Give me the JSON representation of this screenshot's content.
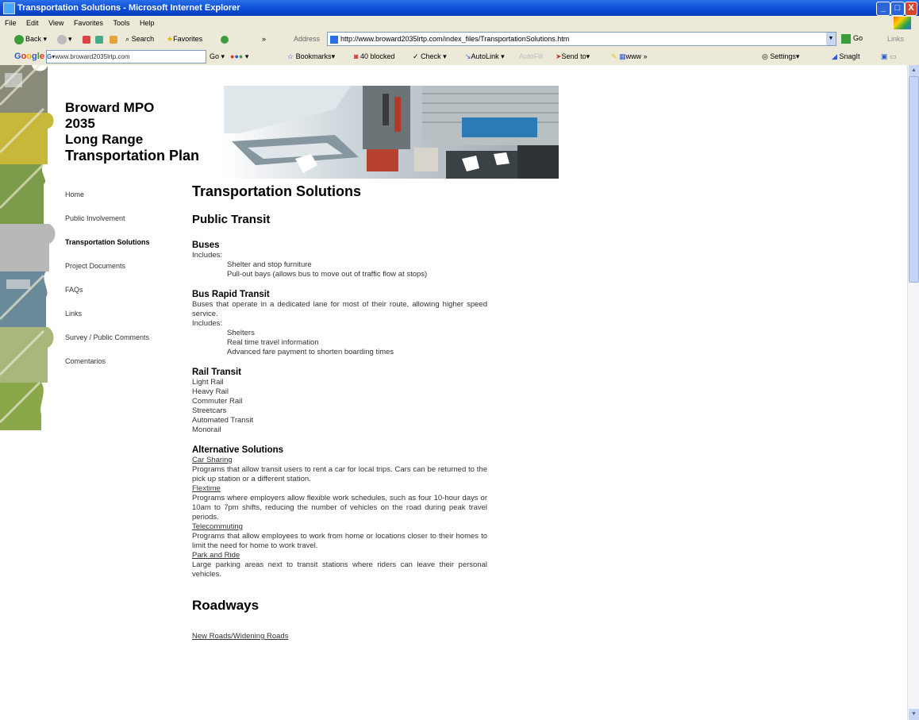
{
  "window": {
    "title": "Transportation Solutions - Microsoft Internet Explorer",
    "controls": [
      "_",
      "□",
      "X"
    ]
  },
  "menu": [
    "File",
    "Edit",
    "View",
    "Favorites",
    "Tools",
    "Help"
  ],
  "toolbar": {
    "back": "Back",
    "search": "Search",
    "favorites": "Favorites",
    "address_label": "Address",
    "address_url": "http://www.broward2035lrtp.com/index_files/TransportationSolutions.htm",
    "go": "Go",
    "links": "Links"
  },
  "google_bar": {
    "logo": "Google",
    "search_value": "www.broward2035lrtp.com",
    "go": "Go",
    "bookmarks": "Bookmarks",
    "blocked": "40 blocked",
    "check": "Check",
    "autolink": "AutoLink",
    "autofill": "AutoFill",
    "sendto": "Send to",
    "more": "www",
    "settings": "Settings",
    "snagit": "SnagIt"
  },
  "brand": {
    "line1": "Broward MPO",
    "line2": "2035",
    "line3": "Long Range",
    "line4": "Transportation Plan"
  },
  "nav": [
    {
      "label": "Home",
      "active": false
    },
    {
      "label": "Public Involvement",
      "active": false
    },
    {
      "label": "Transportation Solutions",
      "active": true
    },
    {
      "label": "Project Documents",
      "active": false
    },
    {
      "label": "FAQs",
      "active": false
    },
    {
      "label": "Links",
      "active": false
    },
    {
      "label": "Survey / Public Comments",
      "active": false
    },
    {
      "label": "Comentarios",
      "active": false
    }
  ],
  "main": {
    "title": "Transportation Solutions",
    "public_transit": "Public Transit",
    "buses": {
      "heading": "Buses",
      "includes": "Includes:",
      "items": [
        "Shelter and stop furniture",
        "Pull-out bays (allows bus to move out of traffic flow at stops)"
      ]
    },
    "brt": {
      "heading": "Bus Rapid Transit",
      "desc": "Buses that operate in a dedicated lane for most of their route, allowing higher speed service.",
      "includes": "Includes:",
      "items": [
        "Shelters",
        "Real time travel information",
        "Advanced fare payment to shorten boarding times"
      ]
    },
    "rail": {
      "heading": "Rail Transit",
      "items": [
        "Light Rail",
        "Heavy Rail",
        "Commuter Rail",
        "Streetcars",
        "Automated Transit",
        "Monorail"
      ]
    },
    "alt": {
      "heading": "Alternative Solutions",
      "car_sharing_link": "Car Sharing",
      "car_sharing_desc": "Programs that allow transit users to rent a car for local trips.  Cars can be returned to the pick up station or a different station.",
      "flextime_link": "Flextime",
      "flextime_desc": "Programs where employers allow flexible work schedules, such as four 10-hour days or 10am to 7pm shifts, reducing the number of vehicles on the road during peak travel periods.",
      "telecommuting_link": "Telecommuting",
      "telecommuting_desc": "Programs that allow employees to work from home or locations closer to their homes to limit the need for home to work travel.",
      "park_ride_link": "Park and Ride",
      "park_ride_desc": "Large parking areas next to transit stations where riders can leave their personal vehicles."
    },
    "roadways": "Roadways",
    "new_roads_link": "New Roads/Widening Roads"
  }
}
